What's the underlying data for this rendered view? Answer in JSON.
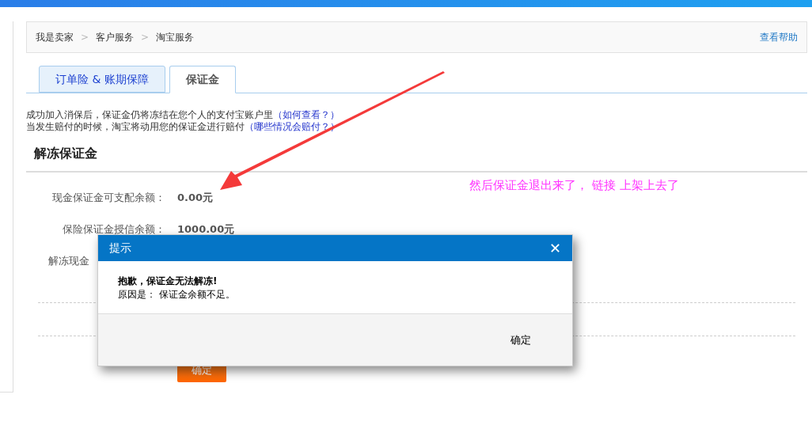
{
  "breadcrumb": {
    "items": [
      "我是卖家",
      "客户服务",
      "淘宝服务"
    ],
    "separator": ">",
    "help_link": "查看帮助"
  },
  "tabs": [
    {
      "label": "订单险 & 账期保障",
      "selected": false
    },
    {
      "label": "保证金",
      "selected": true
    }
  ],
  "notes": [
    {
      "text": "成功加入消保后，保证金仍将冻结在您个人的支付宝账户里",
      "link": "（如何查看？）"
    },
    {
      "text": "当发生赔付的时候，淘宝将动用您的保证金进行赔付",
      "link": "（哪些情况会赔付？）"
    }
  ],
  "section_title": "解冻保证金",
  "fields": [
    {
      "label": "现金保证金可支配余额：",
      "value": "0.00元"
    },
    {
      "label": "保险保证金授信余额：",
      "value": "1000.00元"
    },
    {
      "label": "解冻现金"
    }
  ],
  "submit_button": "确定",
  "annotation": {
    "text": "然后保证金退出来了， 链接 上架上去了"
  },
  "dialog": {
    "title": "提示",
    "close": "✕",
    "message": "抱歉，保证金无法解冻!",
    "reason": "原因是： 保证金余额不足。",
    "button": "确定"
  }
}
